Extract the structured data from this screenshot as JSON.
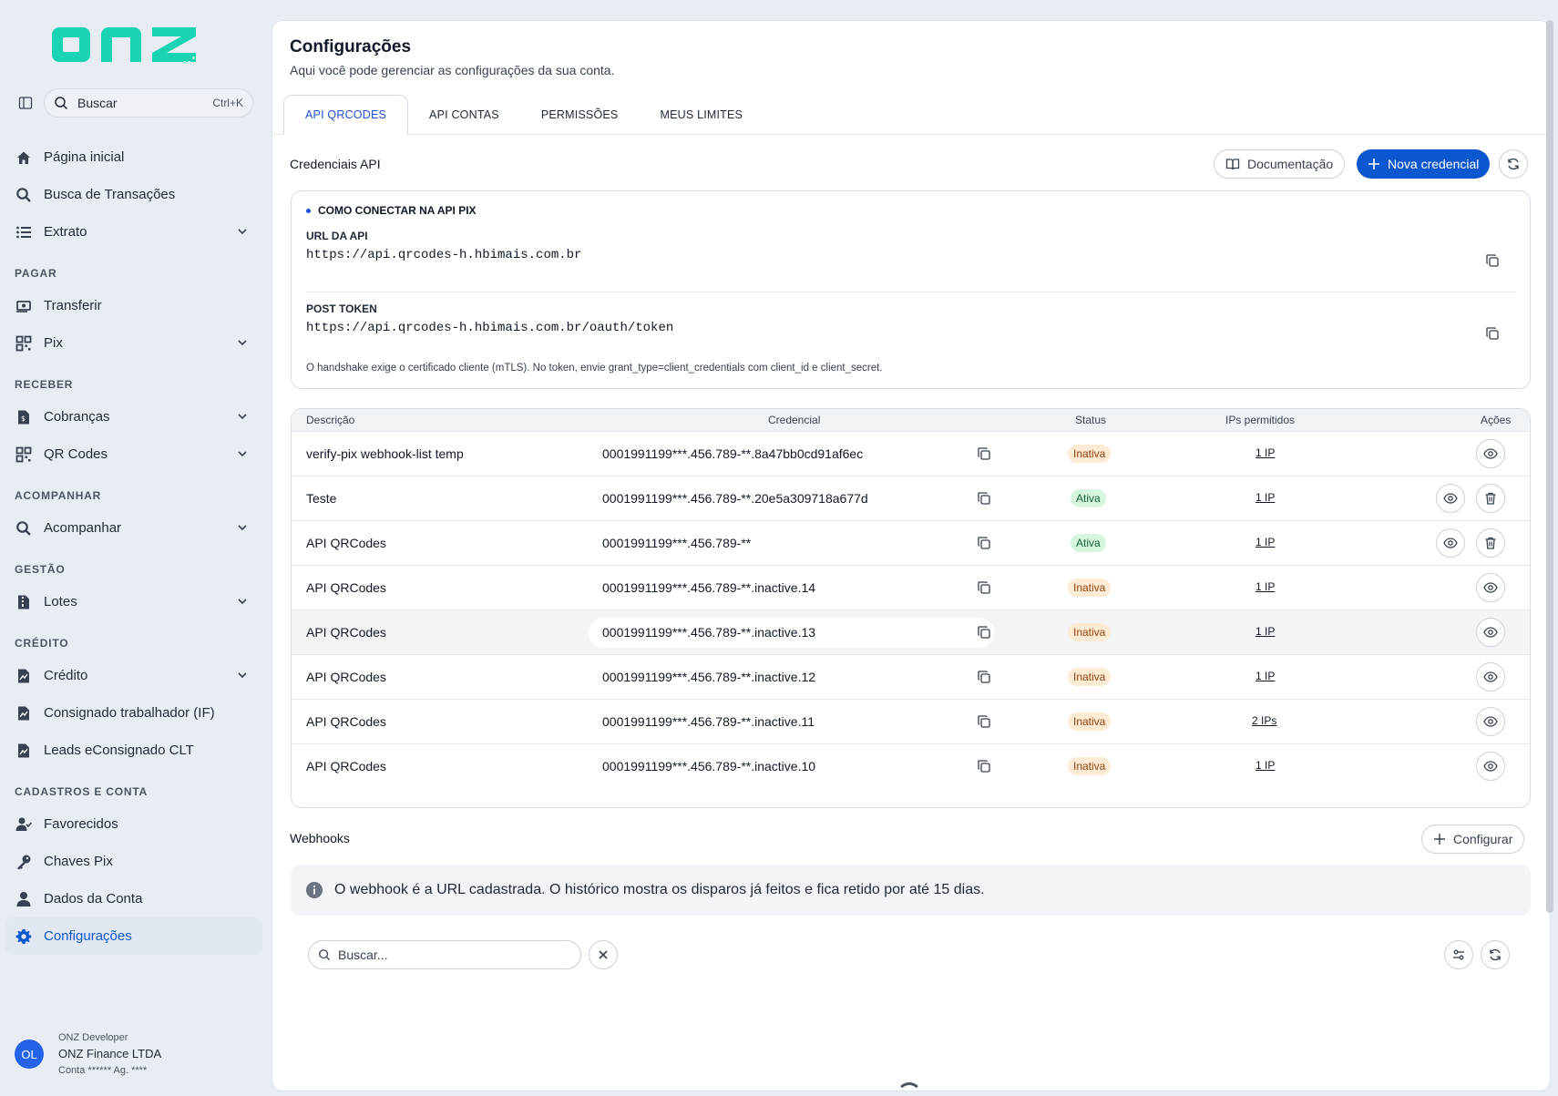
{
  "brand": {
    "logo_text": "onz",
    "accent": "#19d3b3"
  },
  "search": {
    "label": "Buscar",
    "shortcut": "Ctrl+K"
  },
  "nav": {
    "home": "Página inicial",
    "busca": "Busca de Transações",
    "extrato": "Extrato",
    "section_pagar": "PAGAR",
    "transferir": "Transferir",
    "pix": "Pix",
    "section_receber": "RECEBER",
    "cobrancas": "Cobranças",
    "qrcodes": "QR Codes",
    "section_acompanhar": "ACOMPANHAR",
    "acompanhar": "Acompanhar",
    "section_gestao": "GESTÃO",
    "lotes": "Lotes",
    "section_credito": "CRÉDITO",
    "credito": "Crédito",
    "consignado": "Consignado trabalhador (IF)",
    "leads": "Leads eConsignado CLT",
    "section_cadastros": "CADASTROS E CONTA",
    "favorecidos": "Favorecidos",
    "chaves": "Chaves Pix",
    "dados": "Dados da Conta",
    "config": "Configurações"
  },
  "user": {
    "initials": "OL",
    "role": "ONZ Developer",
    "company": "ONZ Finance LTDA",
    "account": "Conta ****** Ag. ****"
  },
  "page": {
    "title": "Configurações",
    "subtitle": "Aqui você pode gerenciar as configurações da sua conta."
  },
  "tabs": [
    "API QRCODES",
    "API CONTAS",
    "PERMISSÕES",
    "MEUS LIMITES"
  ],
  "credentials": {
    "title": "Credenciais API",
    "doc_button": "Documentação",
    "new_button": "Nova credencial"
  },
  "connect": {
    "heading": "COMO CONECTAR NA API PIX",
    "url_label": "URL DA API",
    "url_value": "https://api.qrcodes-h.hbimais.com.br",
    "token_label": "POST TOKEN",
    "token_value": "https://api.qrcodes-h.hbimais.com.br/oauth/token",
    "note": "O handshake exige o certificado cliente (mTLS). No token, envie grant_type=client_credentials com client_id e client_secret."
  },
  "table": {
    "headers": {
      "desc": "Descrição",
      "cred": "Credencial",
      "status": "Status",
      "ips": "IPs permitidos",
      "actions": "Ações"
    },
    "rows": [
      {
        "desc": "verify-pix webhook-list temp",
        "cred": "0001991199***.456.789-**.8a47bb0cd91af6ec",
        "status": "Inativa",
        "ips": "1 IP"
      },
      {
        "desc": "Teste",
        "cred": "0001991199***.456.789-**.20e5a309718a677d",
        "status": "Ativa",
        "ips": "1 IP"
      },
      {
        "desc": "API QRCodes",
        "cred": "0001991199***.456.789-**",
        "status": "Ativa",
        "ips": "1 IP"
      },
      {
        "desc": "API QRCodes",
        "cred": "0001991199***.456.789-**.inactive.14",
        "status": "Inativa",
        "ips": "1 IP"
      },
      {
        "desc": "API QRCodes",
        "cred": "0001991199***.456.789-**.inactive.13",
        "status": "Inativa",
        "ips": "1 IP"
      },
      {
        "desc": "API QRCodes",
        "cred": "0001991199***.456.789-**.inactive.12",
        "status": "Inativa",
        "ips": "1 IP"
      },
      {
        "desc": "API QRCodes",
        "cred": "0001991199***.456.789-**.inactive.11",
        "status": "Inativa",
        "ips": "2 IPs"
      },
      {
        "desc": "API QRCodes",
        "cred": "0001991199***.456.789-**.inactive.10",
        "status": "Inativa",
        "ips": "1 IP"
      }
    ]
  },
  "webhooks": {
    "title": "Webhooks",
    "config_button": "Configurar",
    "info": "O webhook é a URL cadastrada. O histórico mostra os disparos já feitos e fica retido por até 15 dias.",
    "search_placeholder": "Buscar..."
  }
}
